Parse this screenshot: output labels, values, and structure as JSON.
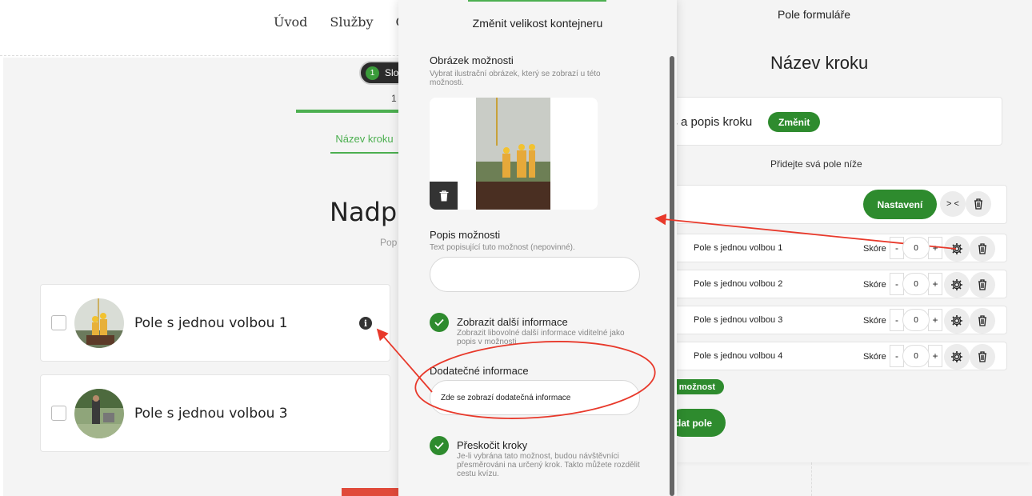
{
  "nav": [
    "Úvod",
    "Služby",
    "Ce"
  ],
  "preview": {
    "step_pill": "Slou",
    "step_number": "1",
    "step_count": "1",
    "step_tab": "Název kroku",
    "heading": "Nadpi",
    "subheading": "Pop",
    "options": [
      {
        "label": "Pole s jednou volbou 1"
      },
      {
        "label": "Pole s jednou volbou 3"
      }
    ],
    "info_glyph": "i"
  },
  "modal": {
    "title": "Změnit velikost kontejneru",
    "image_label": "Obrázek možnosti",
    "image_help": "Vybrat ilustrační obrázek, který se zobrazí u této možnosti.",
    "desc_label": "Popis možnosti",
    "desc_help": "Text popisující tuto možnost (nepovinné).",
    "desc_value": "",
    "show_info_label": "Zobrazit další informace",
    "show_info_help": "Zobrazit libovolné další informace viditelné jako popis v možnosti.",
    "extra_label": "Dodatečné informace",
    "extra_value": "Zde se zobrazí dodatečná informace",
    "skip_label": "Přeskočit kroky",
    "skip_help": "Je-li vybrána tato možnost, budou návštěvníci přesměrováni na určený krok. Takto můžete rozdělit cestu kvízu."
  },
  "builder": {
    "title": "Pole formuláře",
    "step_title": "Název kroku",
    "box_text": "is a popis kroku",
    "change_label": "Změnit",
    "hint": "Přidejte svá pole níže",
    "settings_label": "Nastavení",
    "collapse_glyph": "> <",
    "score_label": "Skóre",
    "rows": [
      {
        "label": "Pole s jednou volbou 1",
        "score": "0"
      },
      {
        "label": "Pole s jednou volbou 2",
        "score": "0"
      },
      {
        "label": "Pole s jednou volbou 3",
        "score": "0"
      },
      {
        "label": "Pole s jednou volbou 4",
        "score": "0"
      }
    ],
    "minus": "-",
    "plus": "+",
    "add_option_label": "možnost",
    "add_field_label": "dat pole"
  },
  "colors": {
    "accent_green": "#2e8b2e",
    "annotation_red": "#e8392b"
  }
}
